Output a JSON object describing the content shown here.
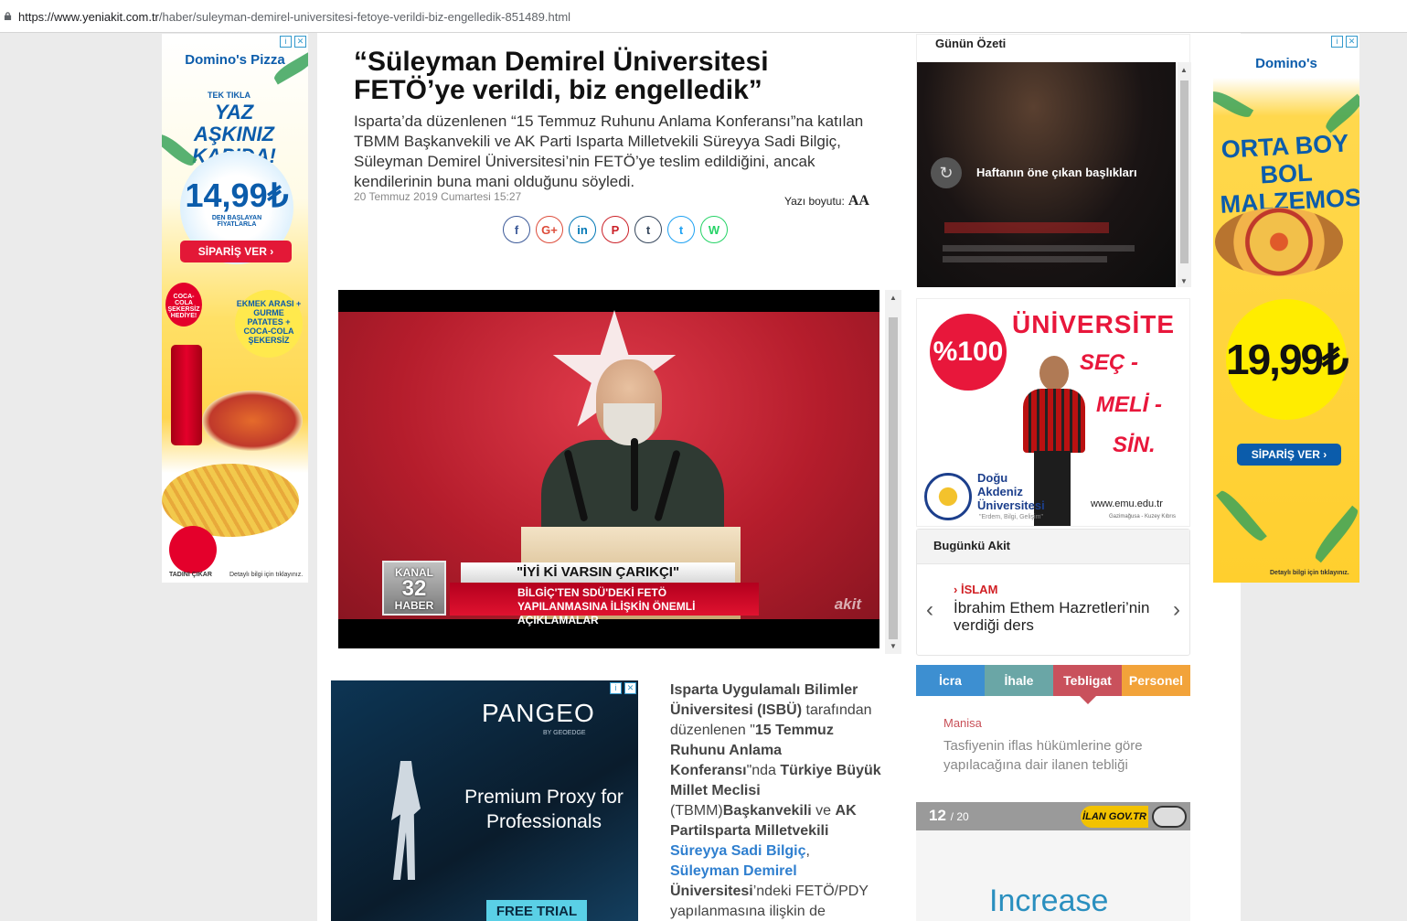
{
  "browser": {
    "url_host": "https://www.yeniakit.com.tr",
    "url_path": "/haber/suleyman-demirel-universitesi-fetoye-verildi-biz-engelledik-851489.html"
  },
  "ad_left": {
    "brand": "Domino's Pizza",
    "tek_tikla": "TEK TIKLA",
    "headline": "YAZ AŞKINIZ KAPIDA!",
    "price": "14,99₺",
    "price_note": "DEN BAŞLAYAN FİYATLARLA",
    "cta": "SİPARİŞ VER",
    "gift": "COCA-COLA ŞEKERSİZ HEDİYE!",
    "combo": "EKMEK ARASI + GURME PATATES + COCA-COLA ŞEKERSİZ",
    "tadini": "TADINI ÇIKAR",
    "details": "Detaylı bilgi için tıklayınız."
  },
  "article": {
    "title": "“Süleyman Demirel Üniversitesi FETÖ’ye verildi, biz engelledik”",
    "lead": "Isparta’da düzenlenen “15 Temmuz Ruhunu Anlama Konferansı”na katılan TBMM Başkanvekili ve AK Parti Isparta Milletvekili Süreyya Sadi Bilgiç, Süleyman Demirel Üniversitesi’nin FETÖ’ye teslim edildiğini, ancak kendilerinin buna mani olduğunu söyledi.",
    "date": "20 Temmuz 2019 Cumartesi 15:27",
    "font_size_label": "Yazı boyutu:",
    "font_size_glyph": "AA"
  },
  "share": [
    {
      "icon": "facebook-icon",
      "glyph": "f",
      "color": "#3b5998"
    },
    {
      "icon": "google-plus-icon",
      "glyph": "G+",
      "color": "#dd4b39"
    },
    {
      "icon": "linkedin-icon",
      "glyph": "in",
      "color": "#0077b5"
    },
    {
      "icon": "pinterest-icon",
      "glyph": "P",
      "color": "#cb2027"
    },
    {
      "icon": "tumblr-icon",
      "glyph": "t",
      "color": "#35465c"
    },
    {
      "icon": "twitter-icon",
      "glyph": "t",
      "color": "#1da1f2"
    },
    {
      "icon": "whatsapp-icon",
      "glyph": "W",
      "color": "#25d366"
    }
  ],
  "video": {
    "channel_top": "KANAL",
    "channel_num": "32",
    "channel_bottom": "HABER",
    "line1": "\"İYİ Kİ VARSIN ÇARIKÇI\"",
    "line2": "BİLGİÇ'TEN SDÜ'DEKİ FETÖ YAPILANMASINA İLİŞKİN ÖNEMLİ AÇIKLAMALAR",
    "watermark": "akit"
  },
  "ad_pangeo": {
    "logo": "PANGEO",
    "sub": "BY GEOEDGE",
    "text": "Premium Proxy for Professionals",
    "cta": "FREE TRIAL"
  },
  "body": {
    "p1": "Isparta Uygulamalı Bilimler Üniversitesi (ISBÜ)",
    "p2": " tarafından düzenlenen \"",
    "p3": "15 Temmuz Ruhunu Anlama Konferansı",
    "p4": "\"nda ",
    "p5": "Türkiye Büyük Millet Meclisi",
    "p6": " (TBMM)",
    "p7": "Başkanvekili",
    "p8": " ve ",
    "p9": "AK PartiIsparta Milletvekili",
    "link1": "Süreyya Sadi Bilgiç",
    "p10": ", ",
    "link2": "Süleyman Demirel",
    "p11": "Üniversitesi",
    "p12": "’ndeki FETÖ/PDY yapılanmasına ilişkin de"
  },
  "gunun_ozeti": {
    "heading": "Günün Özeti",
    "caption": "Haftanın öne çıkan başlıkları"
  },
  "ad_uni": {
    "percent": "%100",
    "heading": "ÜNİVERSİTE",
    "hand1": "SEÇ -",
    "hand2": "MELİ -",
    "hand3": "SİN.",
    "name": "Doğu Akdeniz Üniversitesi",
    "motto": "\"Erdem, Bilgi, Gelişim\"",
    "web": "www.emu.edu.tr",
    "place": "Gazimağusa - Kuzey Kıbrıs"
  },
  "bugunku_akit": {
    "heading": "Bugünkü Akit",
    "category": "İSLAM",
    "headline": "İbrahim Ethem Hazretleri’nin verdiği ders"
  },
  "ilan_tabs": [
    {
      "label": "İcra",
      "color": "#3d8fd1"
    },
    {
      "label": "İhale",
      "color": "#6aa6a6"
    },
    {
      "label": "Tebligat",
      "color": "#c9515c"
    },
    {
      "label": "Personel",
      "color": "#f2a33a"
    }
  ],
  "ilan": {
    "city": "Manisa",
    "text": "Tasfiyenin iflas hükümlerine göre yapılacağına dair ilanen tebliği",
    "current": "12",
    "total": "/ 20",
    "logo": "İLAN GOV.TR"
  },
  "bottom_ad": {
    "text": "Increase"
  },
  "ad_right": {
    "brand": "Domino's",
    "headline": "ORTA BOY BOL MALZEMOS",
    "price": "19,99₺",
    "cta": "SİPARİŞ VER",
    "details": "Detaylı bilgi için tıklayınız."
  }
}
